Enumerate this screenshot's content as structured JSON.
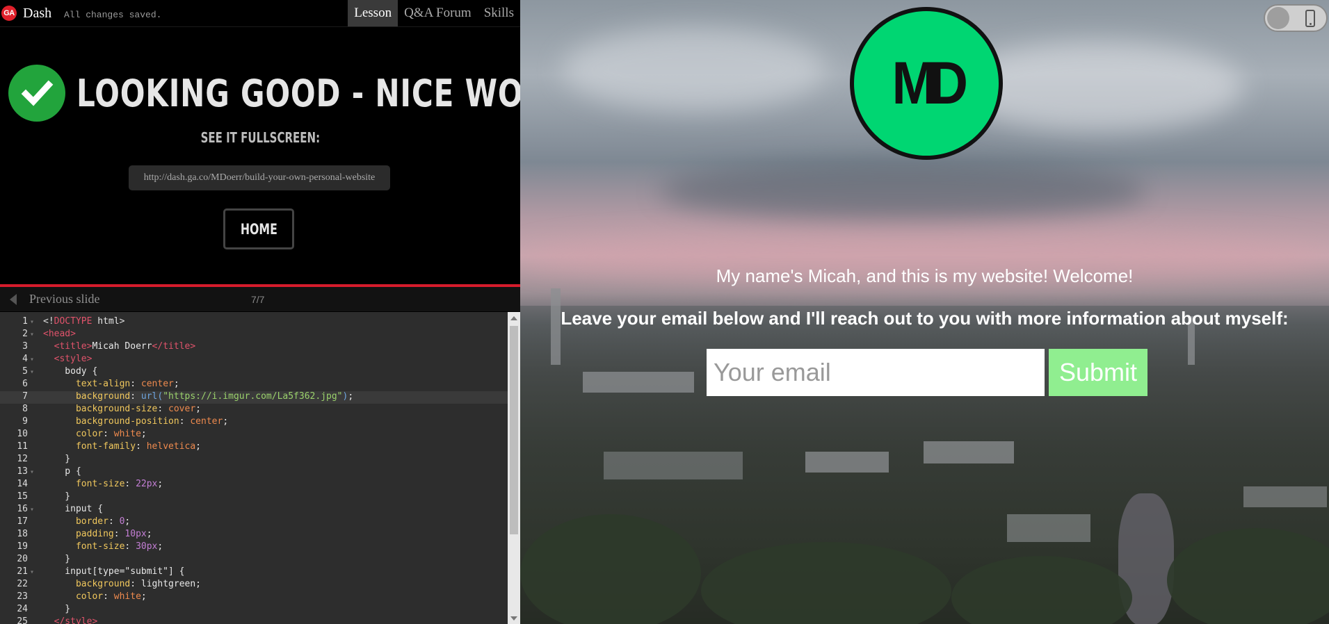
{
  "header": {
    "logo_text": "GA",
    "app_name": "Dash",
    "status": "All changes saved.",
    "tabs": [
      {
        "label": "Lesson",
        "active": true
      },
      {
        "label": "Q&A Forum",
        "active": false
      },
      {
        "label": "Skills",
        "active": false
      }
    ]
  },
  "lesson": {
    "success_title": "LOOKING GOOD - NICE WORK!",
    "see_fullscreen": "SEE IT FULLSCREEN:",
    "url": "http://dash.ga.co/MDoerr/build-your-own-personal-website",
    "home_label": "HOME"
  },
  "slide_nav": {
    "previous_label": "Previous slide",
    "counter": "7/7"
  },
  "editor": {
    "active_line": 7,
    "lines": [
      {
        "n": "1",
        "fold": true
      },
      {
        "n": "2",
        "fold": true
      },
      {
        "n": "3",
        "fold": false
      },
      {
        "n": "4",
        "fold": true
      },
      {
        "n": "5",
        "fold": true
      },
      {
        "n": "6",
        "fold": false
      },
      {
        "n": "7",
        "fold": false
      },
      {
        "n": "8",
        "fold": false
      },
      {
        "n": "9",
        "fold": false
      },
      {
        "n": "10",
        "fold": false
      },
      {
        "n": "11",
        "fold": false
      },
      {
        "n": "12",
        "fold": false
      },
      {
        "n": "13",
        "fold": true
      },
      {
        "n": "14",
        "fold": false
      },
      {
        "n": "15",
        "fold": false
      },
      {
        "n": "16",
        "fold": true
      },
      {
        "n": "17",
        "fold": false
      },
      {
        "n": "18",
        "fold": false
      },
      {
        "n": "19",
        "fold": false
      },
      {
        "n": "20",
        "fold": false
      },
      {
        "n": "21",
        "fold": true
      },
      {
        "n": "22",
        "fold": false
      },
      {
        "n": "23",
        "fold": false
      },
      {
        "n": "24",
        "fold": false
      },
      {
        "n": "25",
        "fold": false
      }
    ],
    "code": [
      [
        [
          "t-p",
          "<!"
        ],
        [
          "t-tag",
          "DOCTYPE"
        ],
        [
          "txt",
          " html"
        ],
        [
          "t-p",
          ">"
        ]
      ],
      [
        [
          "t-tag",
          "<head>"
        ]
      ],
      [
        [
          "txt",
          "  "
        ],
        [
          "t-tag",
          "<title>"
        ],
        [
          "txt",
          "Micah Doerr"
        ],
        [
          "t-tag",
          "</title>"
        ]
      ],
      [
        [
          "txt",
          "  "
        ],
        [
          "t-tag",
          "<style>"
        ]
      ],
      [
        [
          "txt",
          "    body {"
        ]
      ],
      [
        [
          "txt",
          "      "
        ],
        [
          "t-prop",
          "text-align"
        ],
        [
          "txt",
          ": "
        ],
        [
          "t-val",
          "center"
        ],
        [
          "txt",
          ";"
        ]
      ],
      [
        [
          "txt",
          "      "
        ],
        [
          "t-prop",
          "background"
        ],
        [
          "txt",
          ": "
        ],
        [
          "t-fn",
          "url("
        ],
        [
          "t-str",
          "\"https://i.imgur.com/La5f362.jpg\""
        ],
        [
          "t-fn",
          ")"
        ],
        [
          "txt",
          ";"
        ]
      ],
      [
        [
          "txt",
          "      "
        ],
        [
          "t-prop",
          "background-size"
        ],
        [
          "txt",
          ": "
        ],
        [
          "t-val",
          "cover"
        ],
        [
          "txt",
          ";"
        ]
      ],
      [
        [
          "txt",
          "      "
        ],
        [
          "t-prop",
          "background-position"
        ],
        [
          "txt",
          ": "
        ],
        [
          "t-val",
          "center"
        ],
        [
          "txt",
          ";"
        ]
      ],
      [
        [
          "txt",
          "      "
        ],
        [
          "t-prop",
          "color"
        ],
        [
          "txt",
          ": "
        ],
        [
          "t-val",
          "white"
        ],
        [
          "txt",
          ";"
        ]
      ],
      [
        [
          "txt",
          "      "
        ],
        [
          "t-prop",
          "font-family"
        ],
        [
          "txt",
          ": "
        ],
        [
          "t-val",
          "helvetica"
        ],
        [
          "txt",
          ";"
        ]
      ],
      [
        [
          "txt",
          "    }"
        ]
      ],
      [
        [
          "txt",
          "    p {"
        ]
      ],
      [
        [
          "txt",
          "      "
        ],
        [
          "t-prop",
          "font-size"
        ],
        [
          "txt",
          ": "
        ],
        [
          "t-num",
          "22px"
        ],
        [
          "txt",
          ";"
        ]
      ],
      [
        [
          "txt",
          "    }"
        ]
      ],
      [
        [
          "txt",
          "    input {"
        ]
      ],
      [
        [
          "txt",
          "      "
        ],
        [
          "t-prop",
          "border"
        ],
        [
          "txt",
          ": "
        ],
        [
          "t-num",
          "0"
        ],
        [
          "txt",
          ";"
        ]
      ],
      [
        [
          "txt",
          "      "
        ],
        [
          "t-prop",
          "padding"
        ],
        [
          "txt",
          ": "
        ],
        [
          "t-num",
          "10px"
        ],
        [
          "txt",
          ";"
        ]
      ],
      [
        [
          "txt",
          "      "
        ],
        [
          "t-prop",
          "font-size"
        ],
        [
          "txt",
          ": "
        ],
        [
          "t-num",
          "30px"
        ],
        [
          "txt",
          ";"
        ]
      ],
      [
        [
          "txt",
          "    }"
        ]
      ],
      [
        [
          "txt",
          "    input[type=\"submit\"] {"
        ]
      ],
      [
        [
          "txt",
          "      "
        ],
        [
          "t-prop",
          "background"
        ],
        [
          "txt",
          ": lightgreen;"
        ]
      ],
      [
        [
          "txt",
          "      "
        ],
        [
          "t-prop",
          "color"
        ],
        [
          "txt",
          ": "
        ],
        [
          "t-val",
          "white"
        ],
        [
          "txt",
          ";"
        ]
      ],
      [
        [
          "txt",
          "    }"
        ]
      ],
      [
        [
          "txt",
          "  "
        ],
        [
          "t-tag",
          "</style>"
        ]
      ]
    ]
  },
  "preview": {
    "logo_text": "MD",
    "logo_color": "#00d672",
    "welcome": "My name's Micah, and this is my website! Welcome!",
    "leave_email": "Leave your email below and I'll reach out to you with more information about myself:",
    "email_placeholder": "Your email",
    "submit_label": "Submit",
    "submit_color": "#90ee90"
  },
  "colors": {
    "accent_red": "#d51c2c",
    "success_green": "#22a43c"
  }
}
